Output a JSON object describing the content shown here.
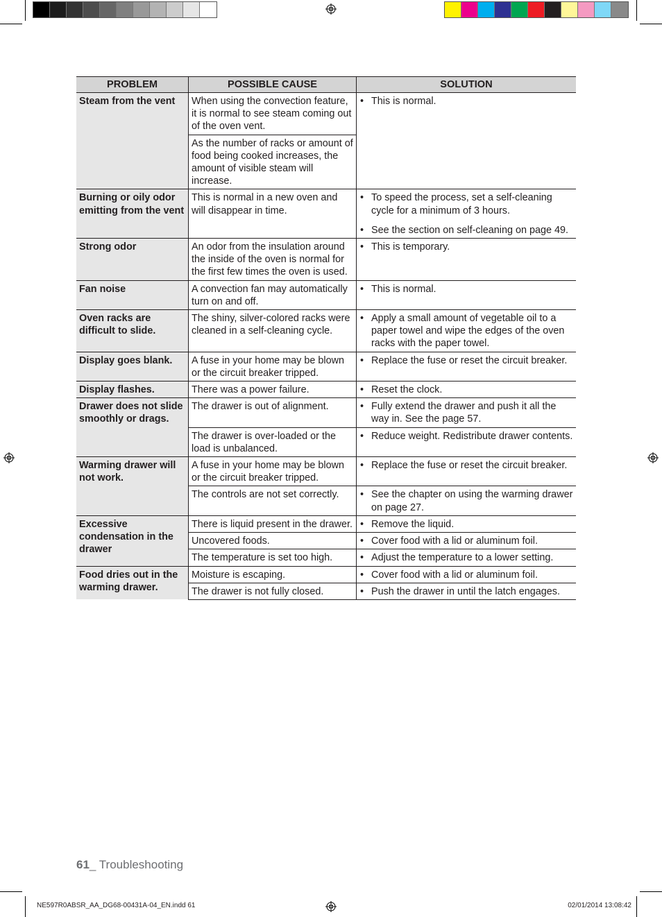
{
  "print_marks": {
    "gray_swatches": [
      "#000000",
      "#1c1c1c",
      "#333333",
      "#4d4d4d",
      "#666666",
      "#808080",
      "#999999",
      "#b3b3b3",
      "#cccccc",
      "#e6e6e6",
      "#ffffff"
    ],
    "color_swatches": [
      "#fff200",
      "#ec008c",
      "#00aeef",
      "#2e3192",
      "#00a651",
      "#ed1c24",
      "#231f20",
      "#fff799",
      "#f49ac1",
      "#7fd8f7",
      "#898989"
    ],
    "registration_icon": "registration-mark-icon"
  },
  "table": {
    "headers": [
      "PROBLEM",
      "POSSIBLE CAUSE",
      "SOLUTION"
    ],
    "rows": [
      {
        "problem": "Steam from the vent",
        "causes": [
          {
            "cause": "When using the convection feature, it is normal to see steam coming out of the oven vent.",
            "solutions": [
              "This is normal."
            ]
          },
          {
            "cause": "As the number of racks or amount of food being cooked increases, the amount of visible steam will increase.",
            "solutions": []
          }
        ]
      },
      {
        "problem": "Burning or oily odor emitting from the vent",
        "causes": [
          {
            "cause": "This is normal in a new oven and will disappear in time.",
            "solutions": [
              "To speed the process, set a self-cleaning cycle for a minimum of 3 hours.",
              "See the section on self-cleaning on page 49."
            ]
          }
        ]
      },
      {
        "problem": "Strong odor",
        "causes": [
          {
            "cause": "An odor from the insulation around the inside of the oven is normal for the first few times the oven is used.",
            "solutions": [
              "This is temporary."
            ]
          }
        ]
      },
      {
        "problem": "Fan noise",
        "causes": [
          {
            "cause": "A convection fan may automatically turn on and off.",
            "solutions": [
              "This is normal."
            ]
          }
        ]
      },
      {
        "problem": "Oven racks are difficult to slide.",
        "causes": [
          {
            "cause": "The shiny, silver-colored racks were cleaned in a self-cleaning cycle.",
            "solutions": [
              "Apply a small amount of vegetable oil to a paper towel and wipe the edges of the oven racks with the paper towel."
            ]
          }
        ]
      },
      {
        "problem": "Display goes blank.",
        "causes": [
          {
            "cause": "A fuse in your home may be blown or the circuit breaker tripped.",
            "solutions": [
              "Replace the fuse or reset the circuit breaker."
            ]
          }
        ]
      },
      {
        "problem": "Display flashes.",
        "causes": [
          {
            "cause": "There was a power failure.",
            "solutions": [
              "Reset the clock."
            ]
          }
        ]
      },
      {
        "problem": "Drawer does not slide smoothly or drags.",
        "causes": [
          {
            "cause": "The drawer is out of alignment.",
            "solutions": [
              "Fully extend the drawer and push it all the way in. See the page 57."
            ]
          },
          {
            "cause": "The drawer is over-loaded or the load is unbalanced.",
            "solutions": [
              "Reduce weight. Redistribute drawer contents."
            ]
          }
        ]
      },
      {
        "problem": "Warming drawer will not work.",
        "causes": [
          {
            "cause": "A fuse in your home may be blown or the circuit breaker tripped.",
            "solutions": [
              "Replace the fuse or reset the circuit breaker."
            ]
          },
          {
            "cause": "The controls are not set correctly.",
            "solutions": [
              "See the chapter on using the warming drawer on page 27."
            ]
          }
        ]
      },
      {
        "problem": "Excessive condensation in the drawer",
        "causes": [
          {
            "cause": "There is liquid present in the drawer.",
            "solutions": [
              "Remove the liquid."
            ]
          },
          {
            "cause": "Uncovered foods.",
            "solutions": [
              "Cover food with a lid or aluminum foil."
            ]
          },
          {
            "cause": "The temperature is set too high.",
            "solutions": [
              "Adjust the temperature to a lower setting."
            ]
          }
        ]
      },
      {
        "problem": "Food dries out in the warming drawer.",
        "causes": [
          {
            "cause": "Moisture is escaping.",
            "solutions": [
              "Cover food with a lid or aluminum foil."
            ]
          },
          {
            "cause": "The drawer is not fully closed.",
            "solutions": [
              "Push the drawer in until the latch engages."
            ]
          }
        ]
      }
    ]
  },
  "footer": {
    "page_number": "61",
    "section": "_ Troubleshooting",
    "slug_file": "NE597R0ABSR_AA_DG68-00431A-04_EN.indd   61",
    "slug_date": "02/01/2014   13:08:42"
  }
}
